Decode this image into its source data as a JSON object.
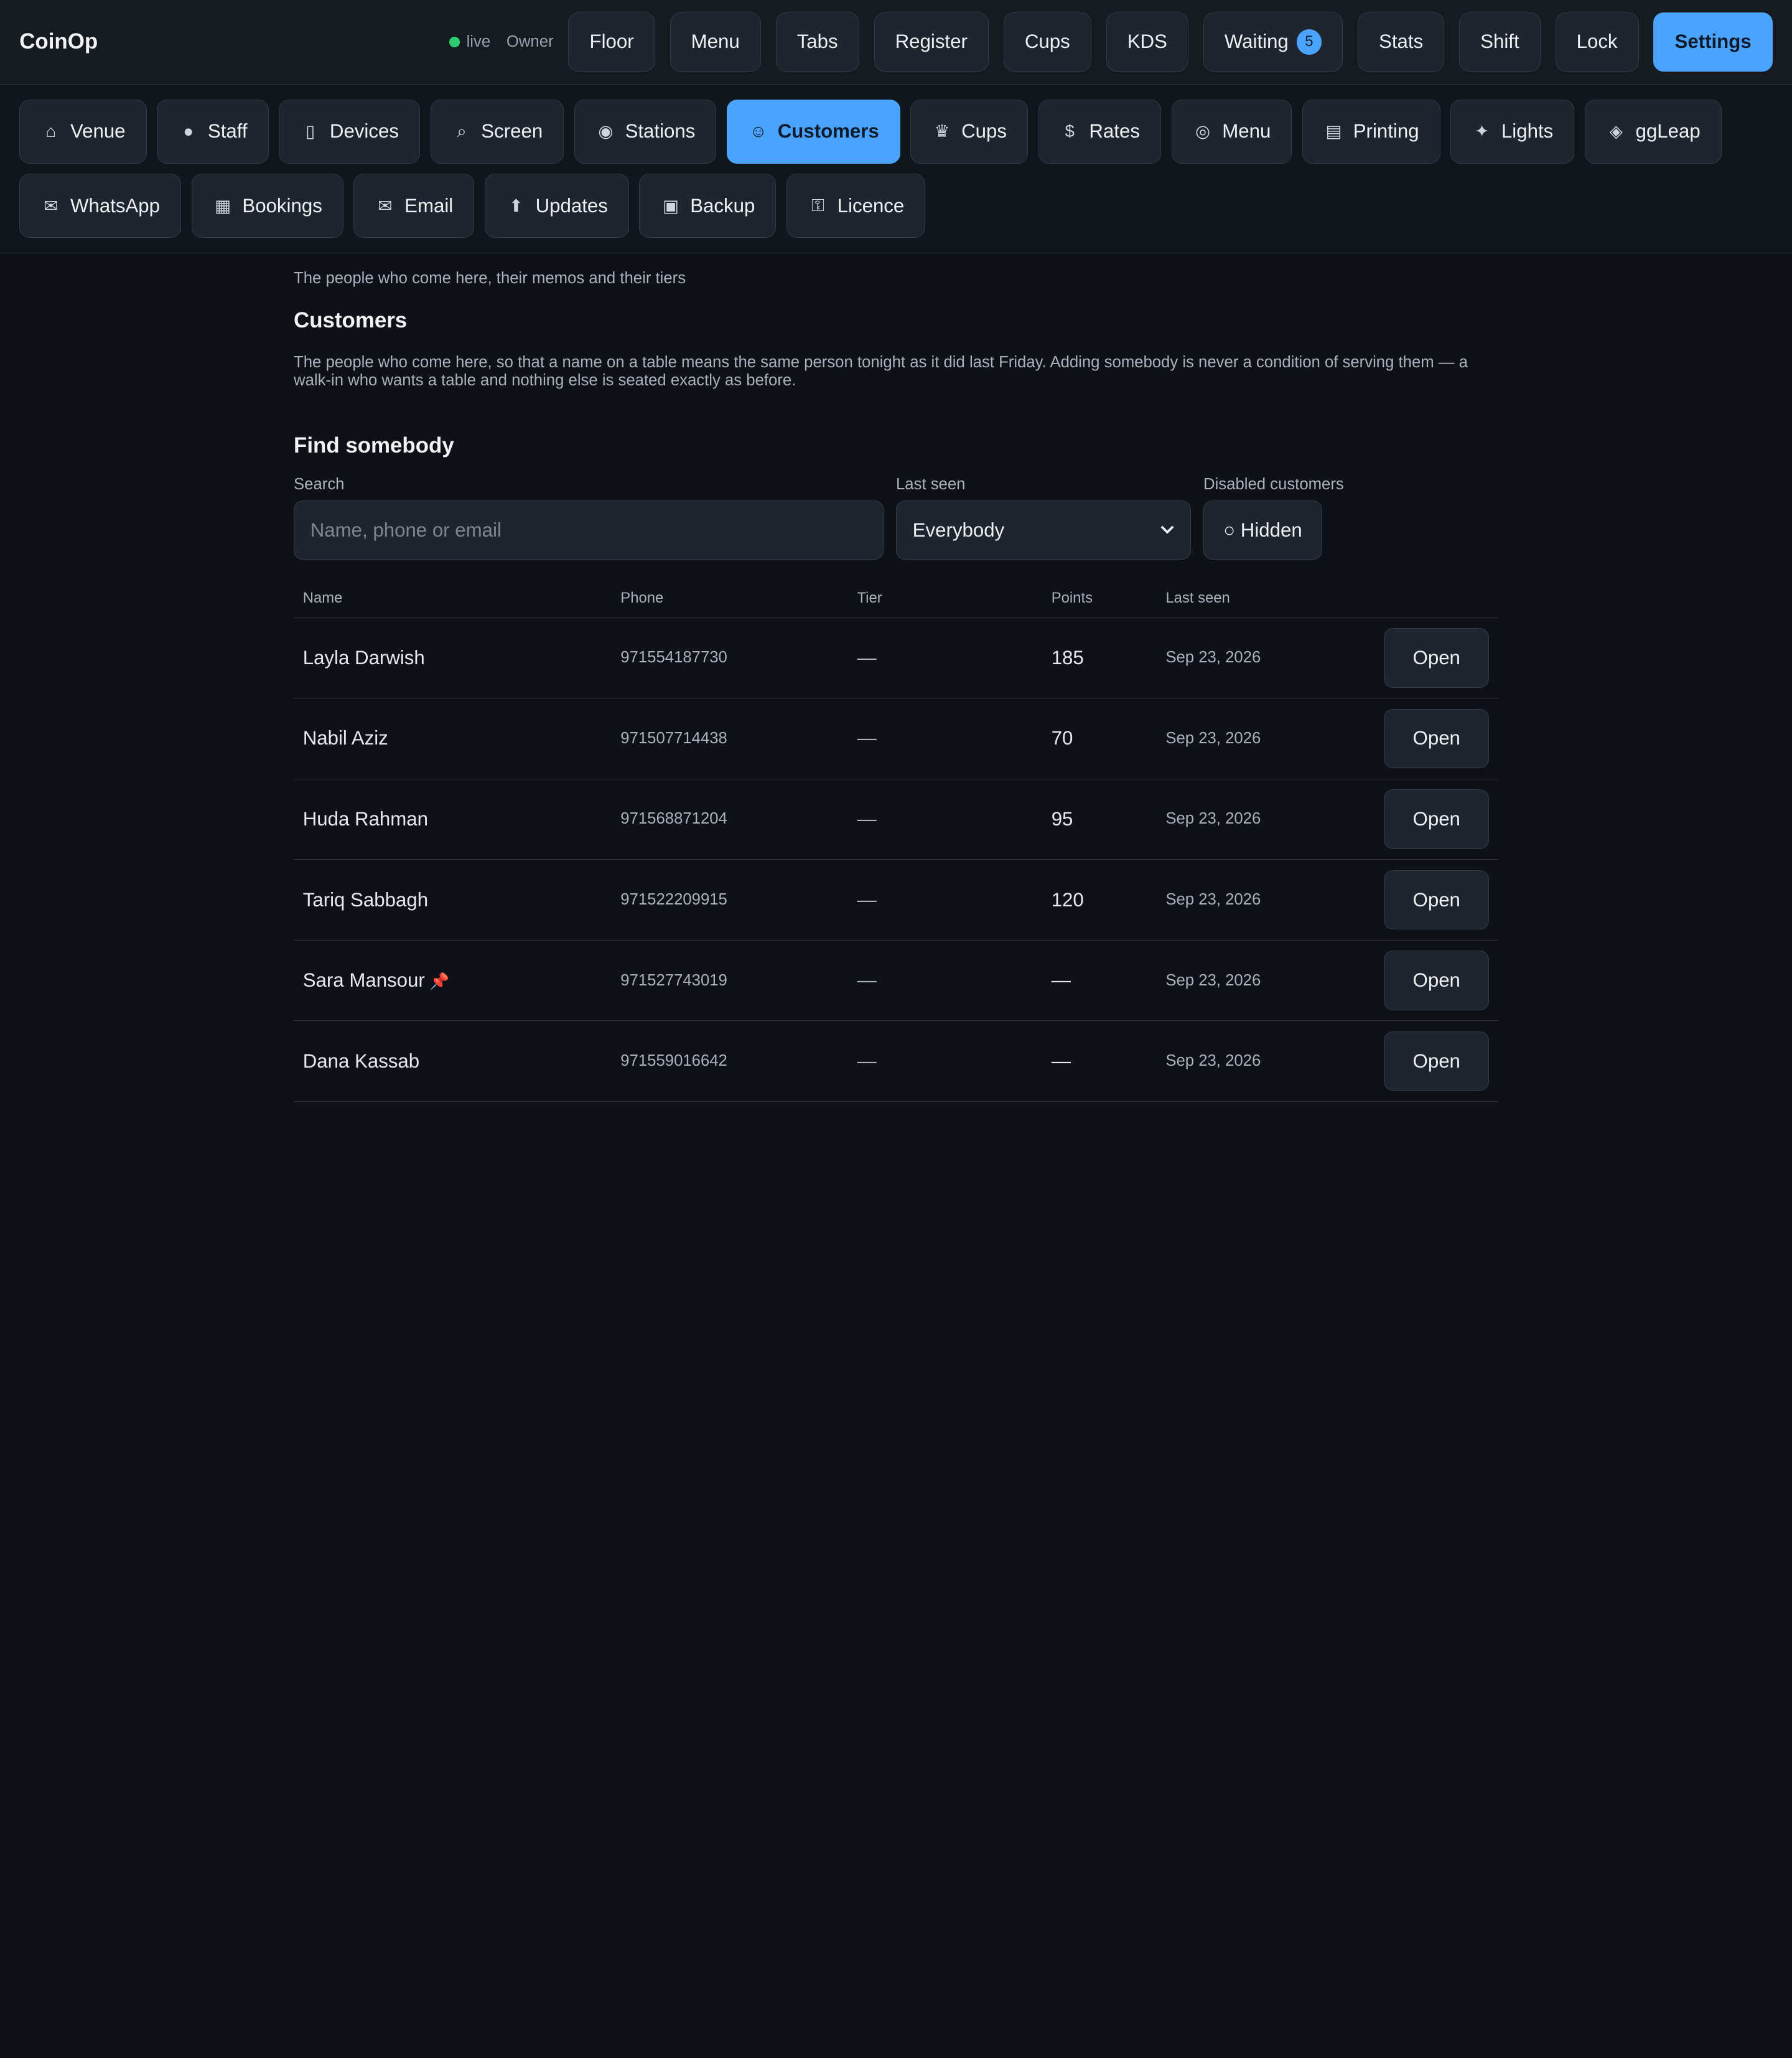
{
  "app": {
    "title": "CoinOp",
    "status": "live",
    "role": "Owner"
  },
  "colors": {
    "accent": "#4aa3ff",
    "live": "#2ecc71",
    "background": "#0e1117"
  },
  "topnav": [
    {
      "label": "Floor"
    },
    {
      "label": "Menu"
    },
    {
      "label": "Tabs"
    },
    {
      "label": "Register"
    },
    {
      "label": "Cups"
    },
    {
      "label": "KDS"
    },
    {
      "label": "Waiting",
      "badge": "5"
    },
    {
      "label": "Stats"
    },
    {
      "label": "Shift"
    },
    {
      "label": "Lock"
    },
    {
      "label": "Settings",
      "active": true
    }
  ],
  "settings_tabs": [
    {
      "label": "Venue",
      "icon": "house-icon",
      "glyph": "⌂"
    },
    {
      "label": "Staff",
      "icon": "user-icon",
      "glyph": "●"
    },
    {
      "label": "Devices",
      "icon": "phone-icon",
      "glyph": "▯"
    },
    {
      "label": "Screen",
      "icon": "magnifier-icon",
      "glyph": "⌕"
    },
    {
      "label": "Stations",
      "icon": "eight-ball-icon",
      "glyph": "◉"
    },
    {
      "label": "Customers",
      "icon": "customer-icon",
      "glyph": "☺",
      "active": true
    },
    {
      "label": "Cups",
      "icon": "trophy-icon",
      "glyph": "♛"
    },
    {
      "label": "Rates",
      "icon": "money-icon",
      "glyph": "$"
    },
    {
      "label": "Menu",
      "icon": "plate-icon",
      "glyph": "◎"
    },
    {
      "label": "Printing",
      "icon": "printer-icon",
      "glyph": "▤"
    },
    {
      "label": "Lights",
      "icon": "bulb-icon",
      "glyph": "✦"
    },
    {
      "label": "ggLeap",
      "icon": "gamepad-icon",
      "glyph": "◈"
    },
    {
      "label": "WhatsApp",
      "icon": "chat-icon",
      "glyph": "✉"
    },
    {
      "label": "Bookings",
      "icon": "calendar-icon",
      "glyph": "▦"
    },
    {
      "label": "Email",
      "icon": "envelope-icon",
      "glyph": "✉"
    },
    {
      "label": "Updates",
      "icon": "arrow-up-icon",
      "glyph": "⬆"
    },
    {
      "label": "Backup",
      "icon": "floppy-icon",
      "glyph": "▣"
    },
    {
      "label": "Licence",
      "icon": "key-icon",
      "glyph": "⚿"
    }
  ],
  "page": {
    "lede": "The people who come here, their memos and their tiers",
    "title": "Customers",
    "intro": "The people who come here, so that a name on a table means the same person tonight as it did last Friday. Adding somebody is never a condition of serving them — a walk-in who wants a table and nothing else is seated exactly as before.",
    "find_title": "Find somebody"
  },
  "filters": {
    "search_label": "Search",
    "search_placeholder": "Name, phone or email",
    "search_value": "",
    "last_seen_label": "Last seen",
    "last_seen_value": "Everybody",
    "disabled_label": "Disabled customers",
    "disabled_value": "○ Hidden"
  },
  "table": {
    "headers": [
      "Name",
      "Phone",
      "Tier",
      "Points",
      "Last seen"
    ],
    "action_label": "Open",
    "rows": [
      {
        "name": "Layla Darwish",
        "phone": "971554187730",
        "tier": "—",
        "points": "185",
        "last_seen": "Sep 23, 2026",
        "pinned": false
      },
      {
        "name": "Nabil Aziz",
        "phone": "971507714438",
        "tier": "—",
        "points": "70",
        "last_seen": "Sep 23, 2026",
        "pinned": false
      },
      {
        "name": "Huda Rahman",
        "phone": "971568871204",
        "tier": "—",
        "points": "95",
        "last_seen": "Sep 23, 2026",
        "pinned": false
      },
      {
        "name": "Tariq Sabbagh",
        "phone": "971522209915",
        "tier": "—",
        "points": "120",
        "last_seen": "Sep 23, 2026",
        "pinned": false
      },
      {
        "name": "Sara Mansour",
        "phone": "971527743019",
        "tier": "—",
        "points": "—",
        "last_seen": "Sep 23, 2026",
        "pinned": true
      },
      {
        "name": "Dana Kassab",
        "phone": "971559016642",
        "tier": "—",
        "points": "—",
        "last_seen": "Sep 23, 2026",
        "pinned": false
      }
    ]
  }
}
